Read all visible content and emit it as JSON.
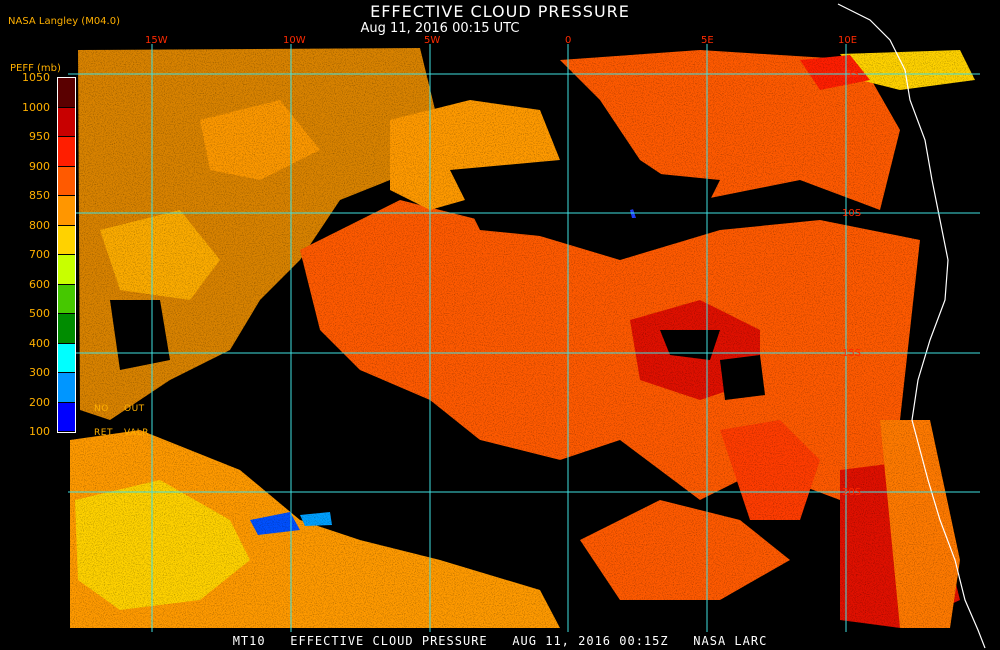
{
  "header": {
    "title": "EFFECTIVE CLOUD PRESSURE",
    "subtitle": "Aug 11, 2016 00:15 UTC",
    "agency": "NASA Langley  (M04.0)"
  },
  "legend": {
    "unit": "PEFF (mb)",
    "labels": [
      "1050",
      "1000",
      "950",
      "900",
      "850",
      "800",
      "700",
      "600",
      "500",
      "400",
      "300",
      "200",
      "100"
    ],
    "colors": [
      "#5a0000",
      "#c80000",
      "#ff1e00",
      "#ff5a00",
      "#ff9600",
      "#ffd200",
      "#c8ff00",
      "#46c800",
      "#008c00",
      "#00ffff",
      "#0096ff",
      "#0000ff",
      "#9632dc"
    ],
    "no_ret": [
      "NO",
      "RET"
    ],
    "out_valr": [
      "OUT",
      "VALR"
    ]
  },
  "graticule": {
    "lon_labels": [
      "15W",
      "10W",
      "5W",
      "0",
      "5E",
      "10E"
    ],
    "lat_labels": [
      "5S",
      "10S",
      "15S",
      "20S"
    ]
  },
  "footer": {
    "text": "MT10   EFFECTIVE CLOUD PRESSURE   AUG 11, 2016 00:15Z   NASA LARC"
  }
}
